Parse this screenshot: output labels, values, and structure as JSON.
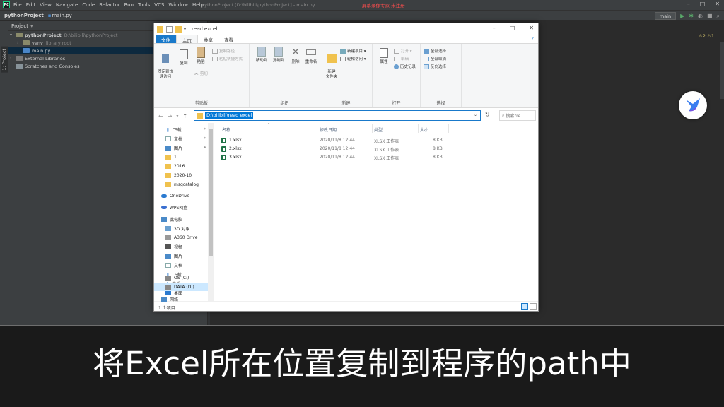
{
  "ide": {
    "menu": [
      "File",
      "Edit",
      "View",
      "Navigate",
      "Code",
      "Refactor",
      "Run",
      "Tools",
      "VCS",
      "Window",
      "Help"
    ],
    "window_title": "pythonProject [D:\\bilibili\\pythonProject] - main.py",
    "recording_badge": "屏幕录像专家 未注册",
    "breadcrumb": [
      "pythonProject",
      "main.py"
    ],
    "run_config": "main",
    "tool_window_label": "1: Project",
    "project_panel_title": "Project",
    "tree": [
      {
        "name": "pythonProject",
        "path": "D:\\bilibili\\pythonProject"
      },
      {
        "name": "venv",
        "path": "library root"
      },
      {
        "name": "main.py"
      },
      {
        "name": "External Libraries"
      },
      {
        "name": "Scratches and Consoles"
      }
    ],
    "warning_count": "⚠2 ⚠1"
  },
  "explorer": {
    "title": "read excel",
    "tabs": [
      "文件",
      "主页",
      "共享",
      "查看"
    ],
    "ribbon": {
      "clipboard": {
        "label": "剪贴板",
        "pin": "固定到快\n速访问",
        "copy": "复制",
        "paste": "粘贴",
        "copy_path": "复制路径",
        "paste_shortcut": "粘贴快捷方式",
        "cut": "剪切"
      },
      "organize": {
        "label": "组织",
        "move_to": "移动到",
        "copy_to": "复制到",
        "delete": "删除",
        "rename": "重命名"
      },
      "new": {
        "label": "新建",
        "new_folder": "新建\n文件夹",
        "new_item": "新建项目 ▾",
        "easy_access": "轻松访问 ▾"
      },
      "open": {
        "label": "打开",
        "properties": "属性",
        "open": "打开 ▾",
        "edit": "编辑",
        "history": "历史记录"
      },
      "select": {
        "label": "选择",
        "select_all": "全部选择",
        "select_none": "全部取消",
        "invert": "反向选择"
      }
    },
    "address": "D:\\bilibili\\read excel",
    "search_placeholder": "搜索\"re...",
    "nav_items": [
      {
        "label": "下载",
        "pinned": true
      },
      {
        "label": "文档",
        "pinned": true
      },
      {
        "label": "图片",
        "pinned": true
      },
      {
        "label": "1"
      },
      {
        "label": "2016"
      },
      {
        "label": "2020-10"
      },
      {
        "label": "msgcatalog"
      },
      {
        "label": "OneDrive"
      },
      {
        "label": "WPS网盘"
      },
      {
        "label": "此电脑"
      },
      {
        "label": "3D 对象"
      },
      {
        "label": "A360 Drive"
      },
      {
        "label": "视频"
      },
      {
        "label": "图片"
      },
      {
        "label": "文档"
      },
      {
        "label": "下载"
      },
      {
        "label": "音乐"
      },
      {
        "label": "桌面"
      },
      {
        "label": "OS (C:)"
      },
      {
        "label": "DATA (D:)"
      },
      {
        "label": "网络"
      }
    ],
    "columns": [
      "名称",
      "修改日期",
      "类型",
      "大小"
    ],
    "files": [
      {
        "name": "1.xlsx",
        "modified": "2020/11/8 12:44",
        "type": "XLSX 工作表",
        "size": "8 KB"
      },
      {
        "name": "2.xlsx",
        "modified": "2020/11/8 12:44",
        "type": "XLSX 工作表",
        "size": "8 KB"
      },
      {
        "name": "3.xlsx",
        "modified": "2020/11/8 12:44",
        "type": "XLSX 工作表",
        "size": "8 KB"
      }
    ],
    "status": "1 个项目"
  },
  "subtitle": "将Excel所在位置复制到程序的path中"
}
